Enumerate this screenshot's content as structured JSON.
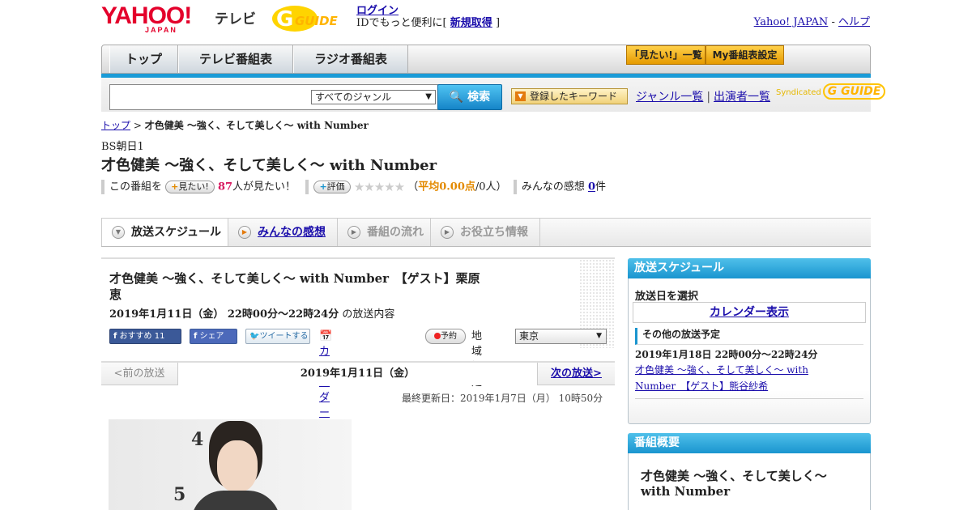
{
  "header": {
    "logo_yahoo": "YAHOO!",
    "logo_japan": "JAPAN",
    "logo_tv": "テレビ",
    "logo_g": "GUIDE",
    "login_link": "ログイン",
    "id_text": "IDでもっと便利に[",
    "signup_link": "新規取得",
    "id_close": "]",
    "yahoo_japan_link": "Yahoo! JAPAN",
    "sep": "-",
    "help_link": "ヘルプ"
  },
  "nav": {
    "tabs": [
      "トップ",
      "テレビ番組表",
      "ラジオ番組表"
    ],
    "mitai_button": "「見たい!」一覧",
    "my_button": "My番組表設定"
  },
  "search": {
    "input_value": "",
    "genre_selected": "すべてのジャンル",
    "search_button": "検索",
    "keyword_button": "登録したキーワード",
    "genre_list_link": "ジャンル一覧",
    "divider": "|",
    "cast_list_link": "出演者一覧",
    "syndicated": "Syndicated",
    "syndicated_g": "G GUIDE"
  },
  "breadcrumb": {
    "top_link": "トップ",
    "sep": ">",
    "current": "才色健美 ～強く、そして美しく～ with Number"
  },
  "program": {
    "channel": "BS朝日1",
    "title": "才色健美 ～強く、そして美しく～ with Number",
    "this_program_label": "この番組を",
    "mitai_pill": "見たい!",
    "mitai_count": "87",
    "mitai_suffix": "人が見たい！",
    "rate_pill": "評価",
    "stars": "★★★★★",
    "avg_open": "（",
    "avg_label": "平均",
    "avg_value": "0.00点",
    "avg_people": "/0人）",
    "impressions_label": "みんなの感想",
    "impressions_count": "0",
    "impressions_suffix": "件"
  },
  "tabs": [
    {
      "label": "放送スケジュール"
    },
    {
      "label": "みんなの感想"
    },
    {
      "label": "番組の流れ"
    },
    {
      "label": "お役立ち情報"
    }
  ],
  "episode": {
    "title": "才色健美 ～強く、そして美しく～ with Number　【ゲスト】栗原恵",
    "date_time": "2019年1月11日（金） 22時00分～22時24分",
    "date_suffix": "の放送内容",
    "fb_recommend": "おすすめ 11",
    "fb_share": "シェア",
    "tweet": "ツイートする",
    "calendar_register": "カレンダーに登録",
    "reserve": "予約",
    "region_label": "地域設定",
    "region_value": "東京"
  },
  "pager": {
    "prev": "<前の放送",
    "date": "2019年1月11日（金）",
    "next": "次の放送>"
  },
  "updated": "最終更新日：2019年1月7日（月） 10時50分",
  "photo": {
    "numbers": [
      "4",
      "5"
    ]
  },
  "schedule_panel": {
    "heading": "放送スケジュール",
    "select_date": "放送日を選択",
    "calendar_link": "カレンダー表示",
    "other_heading": "その他の放送予定",
    "other_date": "2019年1月18日 22時00分～22時24分",
    "other_link": "才色健美 ～強く、そして美しく～ with Number　【ゲスト】熊谷紗希"
  },
  "summary_panel": {
    "heading": "番組概要",
    "title": "才色健美 ～強く、そして美しく～ with Number"
  },
  "colors": {
    "accent_blue": "#1a9bd7",
    "yahoo_red": "#e4002b",
    "orange": "#e38a00",
    "link": "#1a0dab"
  }
}
